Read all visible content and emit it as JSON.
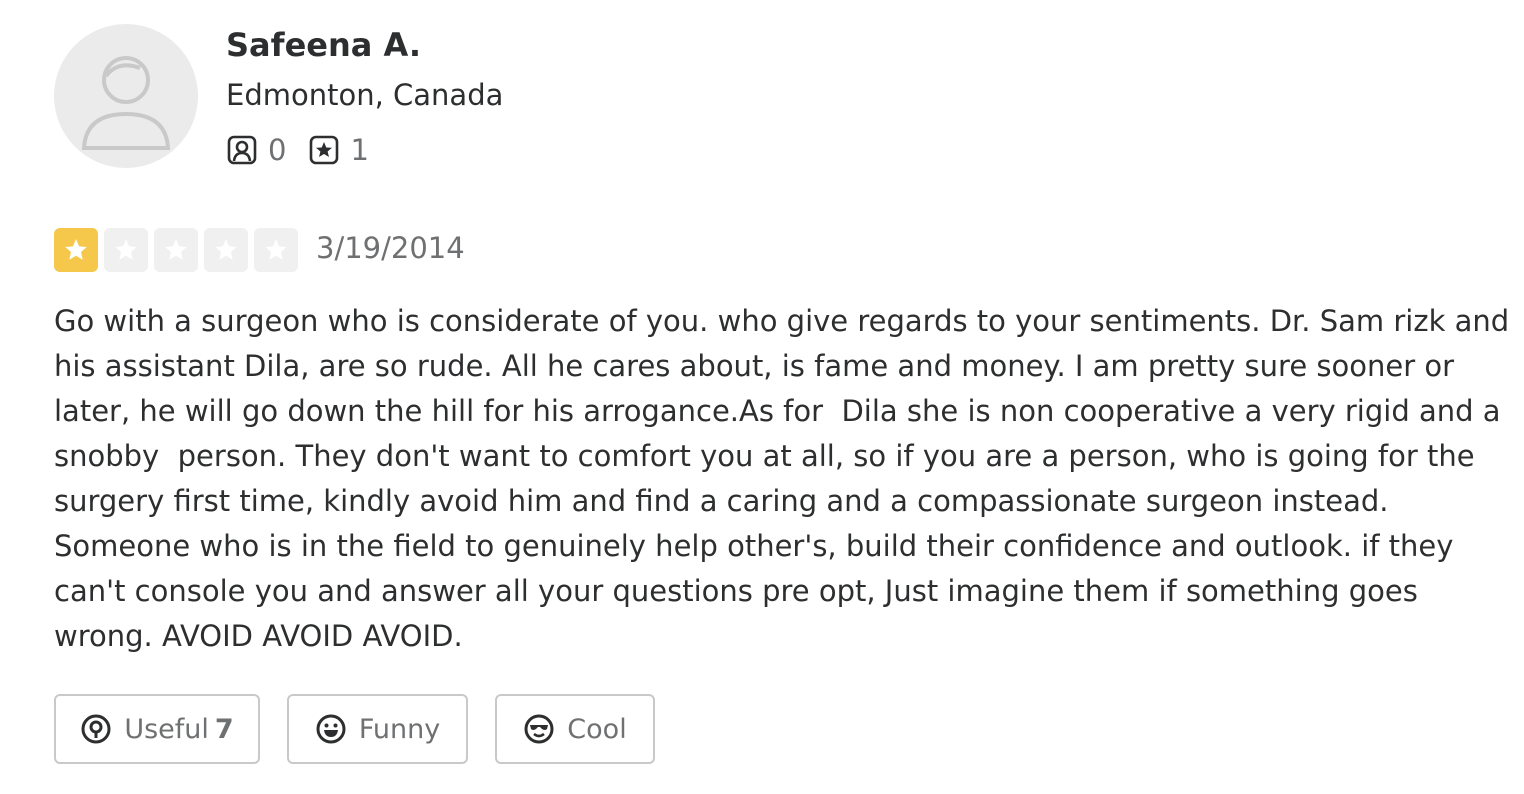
{
  "user": {
    "name": "Safeena A.",
    "location": "Edmonton, Canada",
    "friends_count": "0",
    "reviews_count": "1",
    "friends_icon": "friends-icon",
    "reviews_icon": "review-star-icon"
  },
  "review": {
    "rating": 1,
    "max_rating": 5,
    "date": "3/19/2014",
    "text": "Go with a surgeon who is considerate of you. who give regards to your sentiments. Dr. Sam rizk and\nhis assistant Dila, are so rude. All he cares about, is fame and money. I am pretty sure sooner or\nlater, he will go down the hill for his arrogance.As for  Dila she is non cooperative a very rigid and a\nsnobby  person. They don't want to comfort you at all, so if you are a person, who is going for the\nsurgery first time, kindly avoid him and find a caring and a compassionate surgeon instead.\nSomeone who is in the field to genuinely help other's, build their confidence and outlook. if they\ncan't console you and answer all your questions pre opt, Just imagine them if something goes\nwrong. AVOID AVOID AVOID."
  },
  "reactions": {
    "useful_label": "Useful",
    "useful_count": "7",
    "funny_label": "Funny",
    "cool_label": "Cool"
  },
  "colors": {
    "star_filled": "#f5c84c",
    "star_empty": "#f0f0f0",
    "text": "#2d2e2f",
    "muted": "#6e7072"
  }
}
